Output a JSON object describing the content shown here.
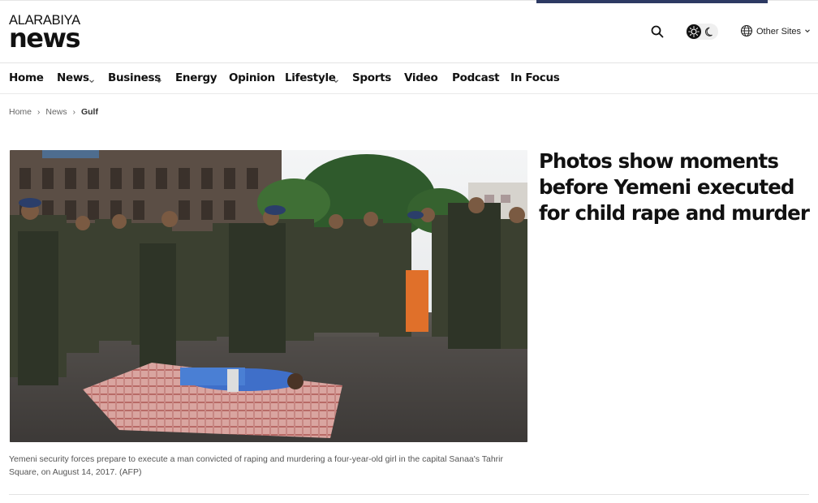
{
  "header": {
    "logo": {
      "brand": "ALARABIYA",
      "name": "news"
    },
    "icons": {
      "search": "search-icon",
      "theme_light": "sun-icon",
      "theme_dark": "moon-icon",
      "globe": "globe-icon"
    },
    "other_sites_label": "Other Sites"
  },
  "nav": {
    "items": [
      {
        "label": "Home",
        "has_dropdown": false
      },
      {
        "label": "News",
        "has_dropdown": true
      },
      {
        "label": "Business",
        "has_dropdown": true
      },
      {
        "label": "Energy",
        "has_dropdown": false
      },
      {
        "label": "Opinion",
        "has_dropdown": false
      },
      {
        "label": "Lifestyle",
        "has_dropdown": true
      },
      {
        "label": "Sports",
        "has_dropdown": false
      },
      {
        "label": "Video",
        "has_dropdown": false
      },
      {
        "label": "Podcast",
        "has_dropdown": false
      },
      {
        "label": "In Focus",
        "has_dropdown": false
      }
    ]
  },
  "breadcrumb": {
    "items": [
      "Home",
      "News",
      "Gulf"
    ]
  },
  "article": {
    "headline": "Photos show moments before Yemeni executed for child rape and murder",
    "image_alt": "Yemeni security forces in a square with a man lying on a blanket",
    "caption": "Yemeni security forces prepare to execute a man convicted of raping and murdering a four-year-old girl in the capital Sanaa's Tahrir Square, on August 14, 2017.",
    "credit": "(AFP)"
  },
  "colors": {
    "accent": "#2d3a63",
    "text": "#111111",
    "muted": "#666666"
  }
}
